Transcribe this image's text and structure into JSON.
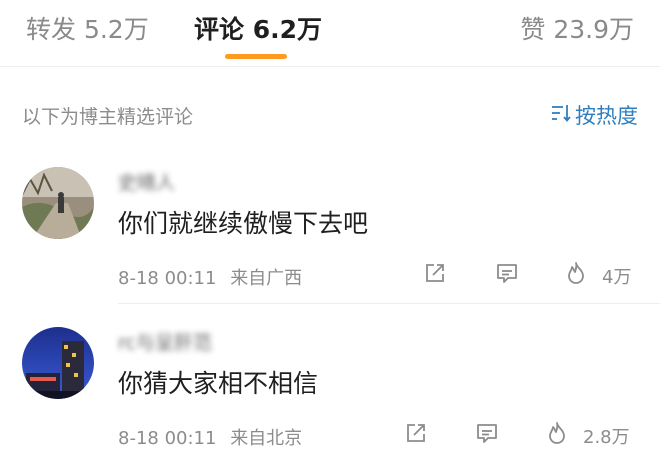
{
  "tabs": {
    "repost": "转发 5.2万",
    "comment": "评论 6.2万",
    "like": "赞 23.9万"
  },
  "filter": {
    "label": "以下为博主精选评论",
    "sort_label": "按热度"
  },
  "comments": [
    {
      "username": "史晴人",
      "text": "你们就继续傲慢下去吧",
      "time": "8-18 00:11",
      "location": "来自广西",
      "likes": "4万"
    },
    {
      "username": "rc与呈肝范",
      "text": "你猜大家相不相信",
      "time": "8-18 00:11",
      "location": "来自北京",
      "likes": "2.8万"
    }
  ],
  "colors": {
    "accent": "#ff9a1f",
    "link": "#2f7fc0",
    "muted": "#8c8c8c"
  }
}
